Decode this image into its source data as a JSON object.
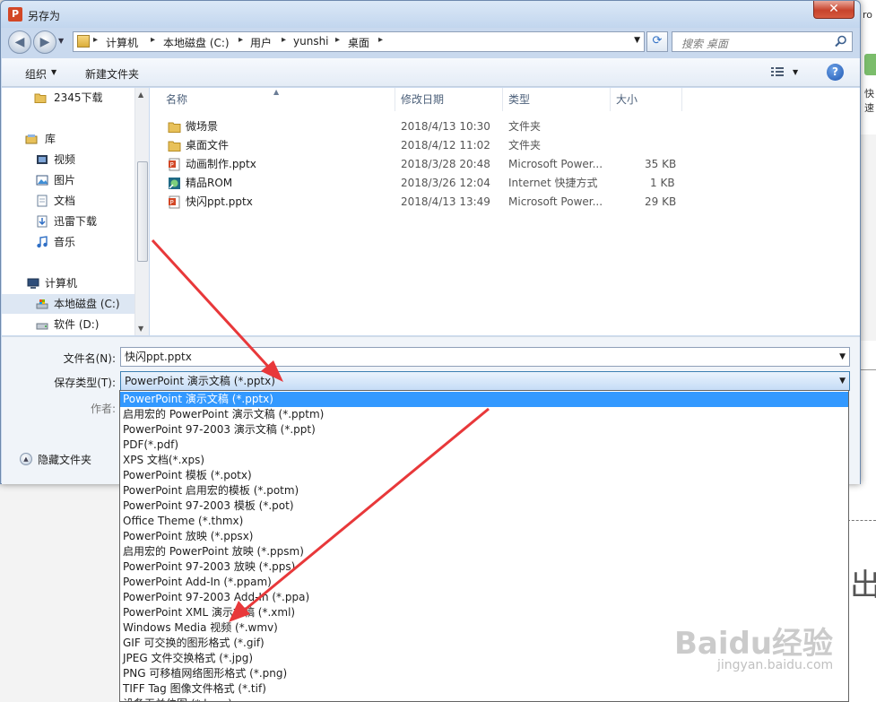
{
  "window": {
    "title": "另存为",
    "close_glyph": "✕"
  },
  "background": {
    "ribbon_text": "ro",
    "ribbon_text2": "快速",
    "glyph": "出"
  },
  "address": {
    "crumbs": [
      "计算机",
      "本地磁盘 (C:)",
      "用户",
      "yunshi",
      "桌面"
    ],
    "search_placeholder": "搜索 桌面"
  },
  "toolbar": {
    "organize": "组织",
    "new_folder": "新建文件夹",
    "help": "?"
  },
  "nav": {
    "items": [
      {
        "label": "2345下载",
        "icon": "folder-icon"
      },
      {
        "label": "库",
        "icon": "library-icon"
      },
      {
        "label": "视频",
        "icon": "video-icon"
      },
      {
        "label": "图片",
        "icon": "picture-icon"
      },
      {
        "label": "文档",
        "icon": "document-icon"
      },
      {
        "label": "迅雷下载",
        "icon": "download-icon"
      },
      {
        "label": "音乐",
        "icon": "music-icon"
      },
      {
        "label": "计算机",
        "icon": "computer-icon"
      },
      {
        "label": "本地磁盘 (C:)",
        "icon": "drive-icon"
      },
      {
        "label": "软件 (D:)",
        "icon": "drive-icon"
      }
    ]
  },
  "files": {
    "columns": [
      "名称",
      "修改日期",
      "类型",
      "大小"
    ],
    "rows": [
      {
        "name": "微场景",
        "date": "2018/4/13 10:30",
        "type": "文件夹",
        "size": "",
        "icon": "folder-icon"
      },
      {
        "name": "桌面文件",
        "date": "2018/4/12 11:02",
        "type": "文件夹",
        "size": "",
        "icon": "folder-icon"
      },
      {
        "name": "动画制作.pptx",
        "date": "2018/3/28 20:48",
        "type": "Microsoft Power...",
        "size": "35 KB",
        "icon": "pptx-icon"
      },
      {
        "name": "精品ROM",
        "date": "2018/3/26 12:04",
        "type": "Internet 快捷方式",
        "size": "1 KB",
        "icon": "shortcut-icon"
      },
      {
        "name": "快闪ppt.pptx",
        "date": "2018/4/13 13:49",
        "type": "Microsoft Power...",
        "size": "29 KB",
        "icon": "pptx-icon"
      }
    ]
  },
  "form": {
    "filename_label": "文件名(N):",
    "filename_value": "快闪ppt.pptx",
    "savetype_label": "保存类型(T):",
    "savetype_value": "PowerPoint 演示文稿 (*.pptx)",
    "author_label": "作者:",
    "hide_folders": "隐藏文件夹"
  },
  "savetype_options": [
    "PowerPoint 演示文稿 (*.pptx)",
    "启用宏的 PowerPoint 演示文稿 (*.pptm)",
    "PowerPoint 97-2003 演示文稿 (*.ppt)",
    "PDF(*.pdf)",
    "XPS 文档(*.xps)",
    "PowerPoint 模板 (*.potx)",
    "PowerPoint 启用宏的模板 (*.potm)",
    "PowerPoint 97-2003 模板 (*.pot)",
    "Office Theme (*.thmx)",
    "PowerPoint 放映 (*.ppsx)",
    "启用宏的 PowerPoint 放映 (*.ppsm)",
    "PowerPoint 97-2003 放映 (*.pps)",
    "PowerPoint Add-In (*.ppam)",
    "PowerPoint 97-2003 Add-In (*.ppa)",
    "PowerPoint XML 演示文稿 (*.xml)",
    "Windows Media 视频 (*.wmv)",
    "GIF 可交换的图形格式 (*.gif)",
    "JPEG 文件交换格式 (*.jpg)",
    "PNG 可移植网络图形格式 (*.png)",
    "TIFF Tag 图像文件格式 (*.tif)",
    "设备无关位图 (*.bmp)"
  ],
  "selected_option_index": 0,
  "watermark": {
    "brand": "Baidu经验",
    "url": "jingyan.baidu.com"
  },
  "colors": {
    "selection": "#3399ff",
    "arrow": "#e8383a"
  }
}
